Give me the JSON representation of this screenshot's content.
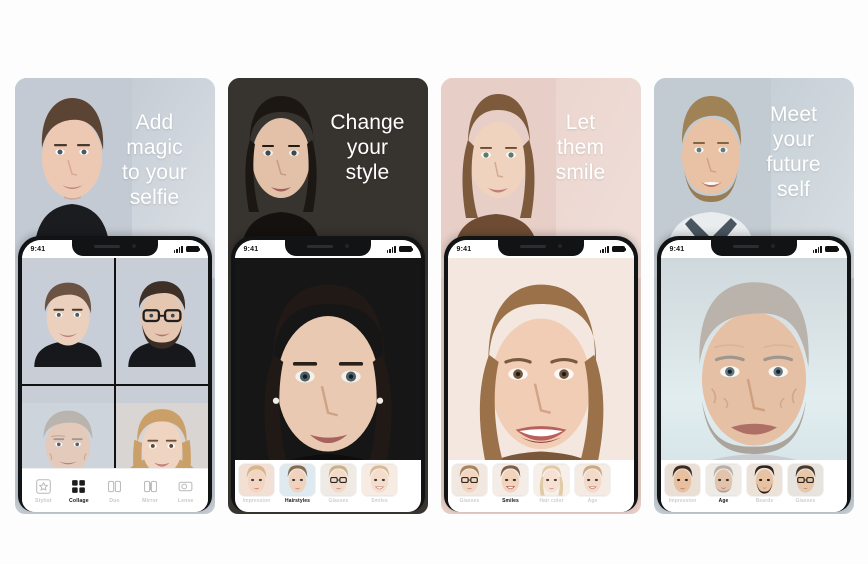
{
  "page": {
    "title": "FaceApp store screenshots",
    "background_color": "#fdfdfd",
    "panel_count": 4
  },
  "panels": [
    {
      "id": "panel-add-magic",
      "headline": "Add\nmagic\nto your\nselfie",
      "headline_lines": [
        "Add",
        "magic",
        "to your",
        "selfie"
      ],
      "hero_bg_color": "#c6ccd4",
      "headline_color": "#ffffff",
      "status_bar": {
        "time": "9:41",
        "signal": "signal-icon",
        "battery": "battery-icon"
      },
      "app_screen": {
        "type": "collage",
        "cells": [
          {
            "label": "young-male-variant",
            "skin": "#e9d3c6",
            "hair": "#6b5242",
            "bg": "#c9d0da"
          },
          {
            "label": "bearded-glasses-variant",
            "skin": "#e4c8b5",
            "hair": "#4a3a2e",
            "bg": "#c9d0da",
            "glasses": true,
            "beard": true
          },
          {
            "label": "older-male-variant",
            "skin": "#e3cbbc",
            "hair": "#b9b4ae",
            "bg": "#c9d0da"
          },
          {
            "label": "female-variant",
            "skin": "#f0d5c4",
            "hair": "#cfa06a",
            "bg": "#d6d3d0"
          }
        ]
      },
      "bottom_bar": {
        "type": "tabbar",
        "items": [
          {
            "label": "Stylist",
            "icon": "star-square-icon",
            "active": false
          },
          {
            "label": "Collage",
            "icon": "grid-four-icon",
            "active": true
          },
          {
            "label": "Duo",
            "icon": "two-panels-icon",
            "active": false
          },
          {
            "label": "Mirror",
            "icon": "mirror-icon",
            "active": false
          },
          {
            "label": "Lense",
            "icon": "lens-icon",
            "active": false
          }
        ]
      }
    },
    {
      "id": "panel-change-style",
      "headline_lines": [
        "Change",
        "your",
        "style"
      ],
      "hero_bg_color": "#3a3631",
      "headline_color": "#ffffff",
      "status_bar": {
        "time": "9:41",
        "signal": "signal-icon",
        "battery": "battery-icon"
      },
      "app_screen": {
        "type": "preview",
        "subject": "dark-haired-woman-portrait",
        "skin": "#e8cbb6",
        "hair": "#241c18",
        "bg": "#151515"
      },
      "bottom_bar": {
        "type": "thumbbar",
        "items": [
          {
            "label": "Impression",
            "active": false,
            "skin": "#f3d8c6",
            "hair": "#d9b98e"
          },
          {
            "label": "Hairstyles",
            "active": true,
            "skin": "#f0d2bd",
            "hair": "#8a6a4c"
          },
          {
            "label": "Glasses",
            "active": false,
            "skin": "#f3d9c8",
            "hair": "#cbb08a",
            "glasses": true
          },
          {
            "label": "Smiles",
            "active": false,
            "skin": "#f5ddcb",
            "hair": "#d8bb96",
            "smile": true
          }
        ]
      }
    },
    {
      "id": "panel-let-them-smile",
      "headline_lines": [
        "Let",
        "them",
        "smile"
      ],
      "hero_bg_color": "#e9cfc8",
      "headline_color": "#ffffff",
      "status_bar": {
        "time": "9:41",
        "signal": "signal-icon",
        "battery": "battery-icon"
      },
      "app_screen": {
        "type": "preview",
        "subject": "smiling-blonde-woman-portrait",
        "skin": "#f0cdb4",
        "hair": "#a5764e",
        "bg": "#f2e6df"
      },
      "bottom_bar": {
        "type": "thumbbar",
        "items": [
          {
            "label": "Glasses",
            "active": false,
            "skin": "#f2d6c2",
            "hair": "#a98459",
            "glasses": true
          },
          {
            "label": "Smiles",
            "active": true,
            "skin": "#f2d4bd",
            "hair": "#7e5f45",
            "smile": true
          },
          {
            "label": "Hair color",
            "active": false,
            "skin": "#f6e1d2",
            "hair": "#e0cba6"
          },
          {
            "label": "Age",
            "active": false,
            "skin": "#f3d9c7",
            "hair": "#c9a982",
            "smile": true
          }
        ]
      }
    },
    {
      "id": "panel-meet-future-self",
      "headline_lines": [
        "Meet",
        "your",
        "future",
        "self"
      ],
      "hero_bg_color": "#c3ccd2",
      "headline_color": "#ffffff",
      "status_bar": {
        "time": "9:41",
        "signal": "signal-icon",
        "battery": "battery-icon"
      },
      "app_screen": {
        "type": "preview",
        "subject": "aged-man-portrait",
        "skin": "#e6c2a9",
        "hair": "#b7b2ab",
        "bg": "#dbe6ea"
      },
      "bottom_bar": {
        "type": "thumbbar",
        "items": [
          {
            "label": "Impression",
            "active": false,
            "skin": "#e8c09f",
            "hair": "#3b2c22"
          },
          {
            "label": "Age",
            "active": true,
            "skin": "#e3c3ab",
            "hair": "#b5b0a9"
          },
          {
            "label": "Beards",
            "active": false,
            "skin": "#e7c3a4",
            "hair": "#2e241c",
            "beard": true
          },
          {
            "label": "Glasses",
            "active": false,
            "skin": "#e8c6a8",
            "hair": "#4a3a2c",
            "glasses": true
          }
        ]
      }
    }
  ]
}
